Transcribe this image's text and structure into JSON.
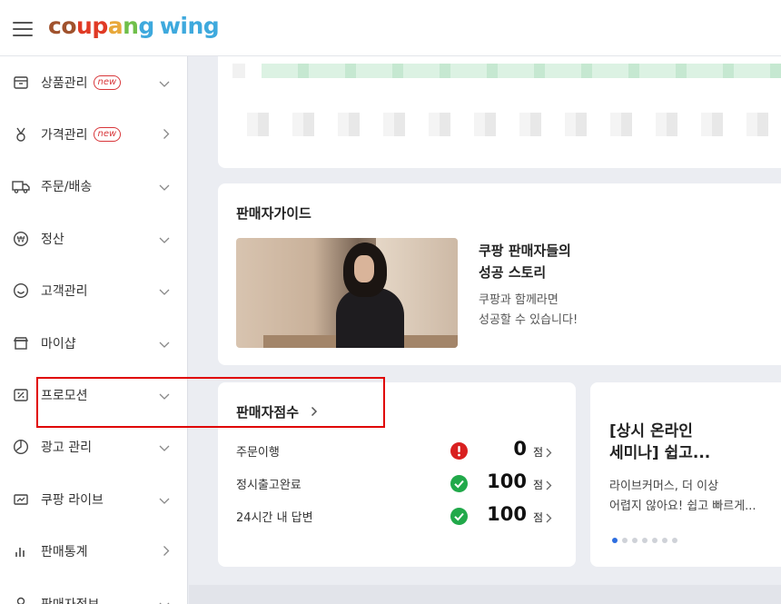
{
  "header": {
    "logo": {
      "coupang": [
        "c",
        "o",
        "u",
        "p",
        "a",
        "n",
        "g"
      ],
      "wing": "wing"
    }
  },
  "sidebar": {
    "items": [
      {
        "label": "상품관리",
        "badge": "new",
        "chevron": "down"
      },
      {
        "label": "가격관리",
        "badge": "new",
        "chevron": "right"
      },
      {
        "label": "주문/배송",
        "badge": "",
        "chevron": "down"
      },
      {
        "label": "정산",
        "badge": "",
        "chevron": "down"
      },
      {
        "label": "고객관리",
        "badge": "",
        "chevron": "down"
      },
      {
        "label": "마이샵",
        "badge": "",
        "chevron": "down"
      },
      {
        "label": "프로모션",
        "badge": "",
        "chevron": "down"
      },
      {
        "label": "광고 관리",
        "badge": "",
        "chevron": "down"
      },
      {
        "label": "쿠팡 라이브",
        "badge": "",
        "chevron": "down"
      },
      {
        "label": "판매통계",
        "badge": "",
        "chevron": "right"
      },
      {
        "label": "판매자정보",
        "badge": "",
        "chevron": "down"
      }
    ]
  },
  "guide": {
    "title": "판매자가이드",
    "heading": "쿠팡 판매자들의\n성공 스토리",
    "desc": "쿠팡과 함께라면\n성공할 수 있습니다!"
  },
  "score": {
    "title": "판매자점수",
    "rows": [
      {
        "name": "주문이행",
        "status": "warning",
        "value": "0",
        "unit": "점"
      },
      {
        "name": "정시출고완료",
        "status": "ok",
        "value": "100",
        "unit": "점"
      },
      {
        "name": "24시간 내 답변",
        "status": "ok",
        "value": "100",
        "unit": "점"
      }
    ]
  },
  "seminar": {
    "title": "[상시 온라인\n세미나] 쉽고...",
    "desc": " 라이브커머스, 더 이상\n어렵지 않아요! 쉽고 빠르게...",
    "dots_total": 7,
    "dots_active_index": 0
  },
  "colors": {
    "accent_blue": "#2d6ee0",
    "warning_red": "#d92020",
    "ok_green": "#21a94a",
    "highlight_red": "#e00000"
  }
}
